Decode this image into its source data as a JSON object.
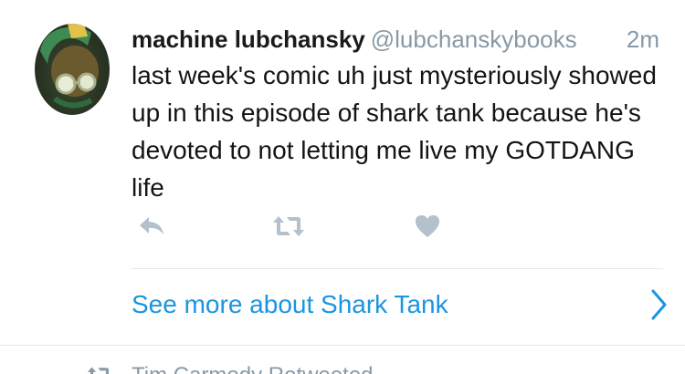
{
  "tweet": {
    "author_name": "machine lubchansky",
    "author_handle": "@lubchanskybooks",
    "time": "2m",
    "text": "last week's comic uh just mysteriously showed up in this episode of shark tank because he's devoted to not letting me live my GOTDANG life",
    "actions": {
      "reply_icon": "reply-icon",
      "retweet_icon": "retweet-icon",
      "like_icon": "heart-icon"
    }
  },
  "see_more": {
    "label": "See more about Shark Tank",
    "icon": "chevron-right-icon"
  },
  "next": {
    "context_label": "Tim Carmody Retweeted",
    "icon": "retweet-icon"
  },
  "colors": {
    "link": "#1b95e0",
    "secondary_text": "#8899a6",
    "action_icon": "#b4c0cc",
    "divider": "#e1e8ed"
  }
}
